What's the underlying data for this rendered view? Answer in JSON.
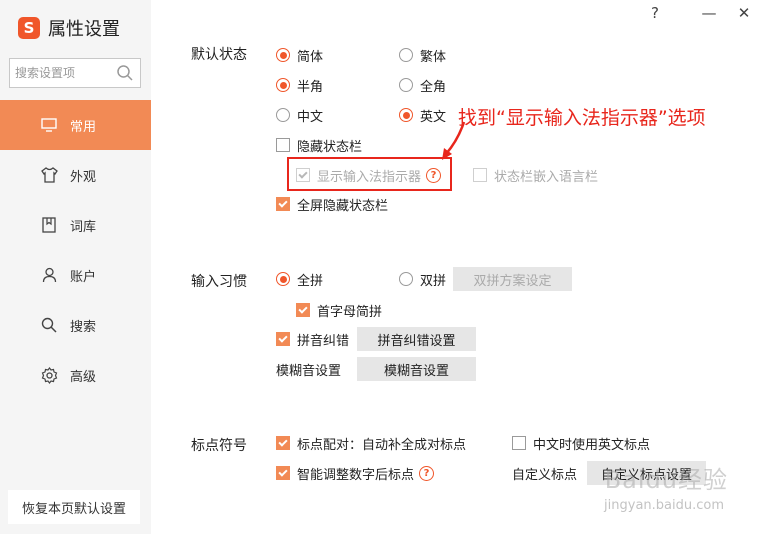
{
  "app": {
    "logo_glyph": "S",
    "title": "属性设置"
  },
  "window_controls": {
    "help": "?",
    "minimize": "—",
    "close": "✕"
  },
  "search": {
    "placeholder": "搜索设置项"
  },
  "nav": [
    {
      "id": "common",
      "label": "常用",
      "icon": "monitor-icon",
      "active": true
    },
    {
      "id": "appearance",
      "label": "外观",
      "icon": "shirt-icon"
    },
    {
      "id": "lexicon",
      "label": "词库",
      "icon": "book-icon"
    },
    {
      "id": "account",
      "label": "账户",
      "icon": "user-icon"
    },
    {
      "id": "search",
      "label": "搜索",
      "icon": "search-icon"
    },
    {
      "id": "advanced",
      "label": "高级",
      "icon": "gear-icon"
    }
  ],
  "restore_button": "恢复本页默认设置",
  "default_state": {
    "label": "默认状态",
    "simplified": "简体",
    "traditional": "繁体",
    "half_width": "半角",
    "full_width": "全角",
    "chinese": "中文",
    "english": "英文",
    "hide_status_bar": "隐藏状态栏",
    "show_ime_indicator": "显示输入法指示器",
    "status_bar_embed": "状态栏嵌入语言栏",
    "fullscreen_hide": "全屏隐藏状态栏"
  },
  "input_habit": {
    "label": "输入习惯",
    "full_pinyin": "全拼",
    "double_pinyin": "双拼",
    "double_pinyin_settings": "双拼方案设定",
    "initial_abbrev": "首字母简拼",
    "pinyin_correction": "拼音纠错",
    "pinyin_correction_settings": "拼音纠错设置",
    "fuzzy_label": "模糊音设置",
    "fuzzy_button": "模糊音设置"
  },
  "punctuation": {
    "label": "标点符号",
    "pairing": "标点配对：自动补全成对标点",
    "english_in_chinese": "中文时使用英文标点",
    "smart_adjust": "智能调整数字后标点",
    "custom_label": "自定义标点",
    "custom_button": "自定义标点设置"
  },
  "annotation": "找到“显示输入法指示器”选项",
  "watermark": {
    "main": "Baidu经验",
    "sub": "jingyan.baidu.com"
  },
  "colors": {
    "accent": "#f0562a",
    "nav_active": "#f28a55",
    "annotation": "#e8261c"
  }
}
